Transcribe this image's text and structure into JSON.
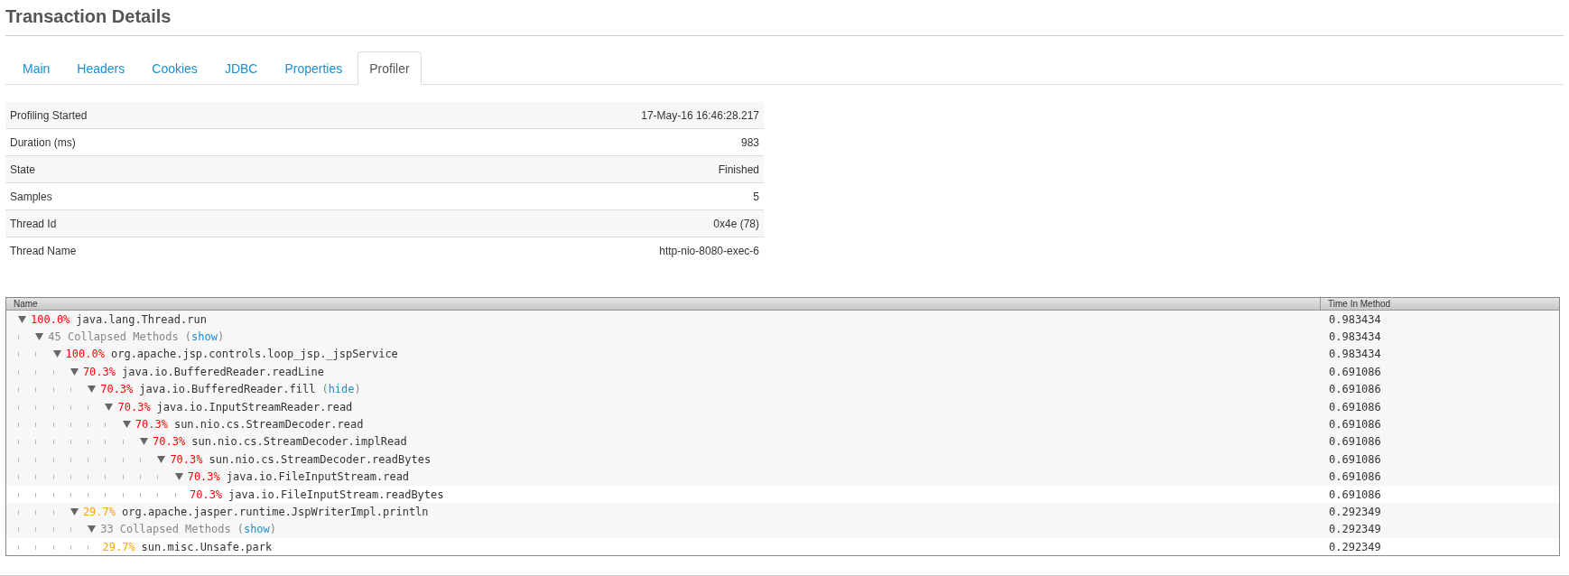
{
  "title": "Transaction Details",
  "tabs": [
    {
      "label": "Main",
      "selected": false
    },
    {
      "label": "Headers",
      "selected": false
    },
    {
      "label": "Cookies",
      "selected": false
    },
    {
      "label": "JDBC",
      "selected": false
    },
    {
      "label": "Properties",
      "selected": false
    },
    {
      "label": "Profiler",
      "selected": true
    }
  ],
  "properties": [
    {
      "label": "Profiling Started",
      "value": "17-May-16 16:46:28.217"
    },
    {
      "label": "Duration (ms)",
      "value": "983"
    },
    {
      "label": "State",
      "value": "Finished"
    },
    {
      "label": "Samples",
      "value": "5"
    },
    {
      "label": "Thread Id",
      "value": "0x4e (78)"
    },
    {
      "label": "Thread Name",
      "value": "http-nio-8080-exec-6"
    }
  ],
  "tree": {
    "columns": [
      "Name",
      "Time In Method"
    ],
    "nodes": [
      {
        "kind": "method",
        "percent": "100.0%",
        "color": "#ff0000",
        "method": "java.lang.Thread.run",
        "time": "0.983434",
        "expanded": true,
        "children": [
          {
            "kind": "collapsed",
            "label": "45 Collapsed Methods",
            "link": {
              "open": "(",
              "text": "show",
              "close": ")"
            },
            "time": "0.983434",
            "expanded": true,
            "children": [
              {
                "kind": "method",
                "percent": "100.0%",
                "color": "#ff0000",
                "method": "org.apache.jsp.controls.loop_jsp._jspService",
                "time": "0.983434",
                "expanded": true,
                "children": [
                  {
                    "kind": "method",
                    "percent": "70.3%",
                    "color": "#ff0000",
                    "method": "java.io.BufferedReader.readLine",
                    "time": "0.691086",
                    "expanded": true,
                    "children": [
                      {
                        "kind": "method",
                        "percent": "70.3%",
                        "color": "#ff0000",
                        "method": "java.io.BufferedReader.fill",
                        "link": {
                          "open": "(",
                          "text": "hide",
                          "close": ")"
                        },
                        "time": "0.691086",
                        "expanded": true,
                        "children": [
                          {
                            "kind": "method",
                            "percent": "70.3%",
                            "color": "#ff0000",
                            "method": "java.io.InputStreamReader.read",
                            "time": "0.691086",
                            "expanded": true,
                            "children": [
                              {
                                "kind": "method",
                                "percent": "70.3%",
                                "color": "#ff0000",
                                "method": "sun.nio.cs.StreamDecoder.read",
                                "time": "0.691086",
                                "expanded": true,
                                "children": [
                                  {
                                    "kind": "method",
                                    "percent": "70.3%",
                                    "color": "#ff0000",
                                    "method": "sun.nio.cs.StreamDecoder.implRead",
                                    "time": "0.691086",
                                    "expanded": true,
                                    "children": [
                                      {
                                        "kind": "method",
                                        "percent": "70.3%",
                                        "color": "#ff0000",
                                        "method": "sun.nio.cs.StreamDecoder.readBytes",
                                        "time": "0.691086",
                                        "expanded": true,
                                        "children": [
                                          {
                                            "kind": "method",
                                            "percent": "70.3%",
                                            "color": "#ff0000",
                                            "method": "java.io.FileInputStream.read",
                                            "time": "0.691086",
                                            "expanded": true,
                                            "children": [
                                              {
                                                "kind": "method",
                                                "percent": "70.3%",
                                                "color": "#ff0000",
                                                "method": "java.io.FileInputStream.readBytes",
                                                "time": "0.691086"
                                              }
                                            ]
                                          }
                                        ]
                                      }
                                    ]
                                  }
                                ]
                              }
                            ]
                          }
                        ]
                      }
                    ]
                  },
                  {
                    "kind": "method",
                    "percent": "29.7%",
                    "color": "#ffa500",
                    "method": "org.apache.jasper.runtime.JspWriterImpl.println",
                    "time": "0.292349",
                    "expanded": true,
                    "children": [
                      {
                        "kind": "collapsed",
                        "label": "33 Collapsed Methods",
                        "link": {
                          "open": "(",
                          "text": "show",
                          "close": ")"
                        },
                        "time": "0.292349",
                        "expanded": true,
                        "children": [
                          {
                            "kind": "method",
                            "percent": "29.7%",
                            "color": "#ffa500",
                            "method": "sun.misc.Unsafe.park",
                            "time": "0.292349"
                          }
                        ]
                      }
                    ]
                  }
                ]
              }
            ]
          }
        ]
      }
    ]
  }
}
